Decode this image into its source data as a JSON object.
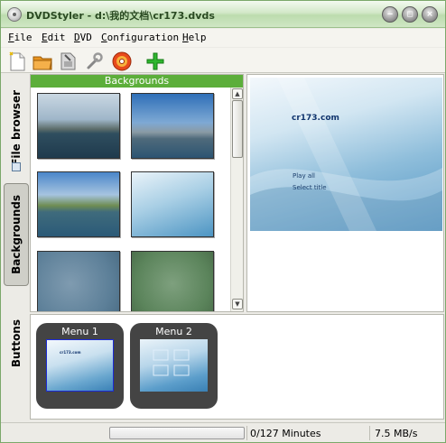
{
  "window": {
    "title": "DVDStyler - d:\\我的文档\\cr173.dvds"
  },
  "menubar": [
    {
      "mnemonic": "F",
      "rest": "ile"
    },
    {
      "mnemonic": "E",
      "rest": "dit"
    },
    {
      "mnemonic": "D",
      "rest": "VD"
    },
    {
      "mnemonic": "C",
      "rest": "onfiguration"
    },
    {
      "mnemonic": "H",
      "rest": "elp"
    }
  ],
  "toolbar": [
    "new-icon",
    "open-icon",
    "save-icon",
    "settings-wrench-icon",
    "burn-disc-icon",
    "add-icon"
  ],
  "tabs": {
    "file_browser": "File browser",
    "backgrounds": "Backgrounds",
    "buttons": "Buttons"
  },
  "backgrounds_panel": {
    "header": "Backgrounds"
  },
  "preview": {
    "title": "cr173.com",
    "items": [
      "Play all",
      "Select title"
    ]
  },
  "menus": [
    {
      "label": "Menu 1",
      "thumb_title": "cr173.com"
    },
    {
      "label": "Menu 2"
    }
  ],
  "status": {
    "progress": 0,
    "minutes": "0/127 Minutes",
    "speed": "7.5 MB/s"
  },
  "colors": {
    "accent": "#5cae3a",
    "preview_blue": "#4f93c2"
  }
}
